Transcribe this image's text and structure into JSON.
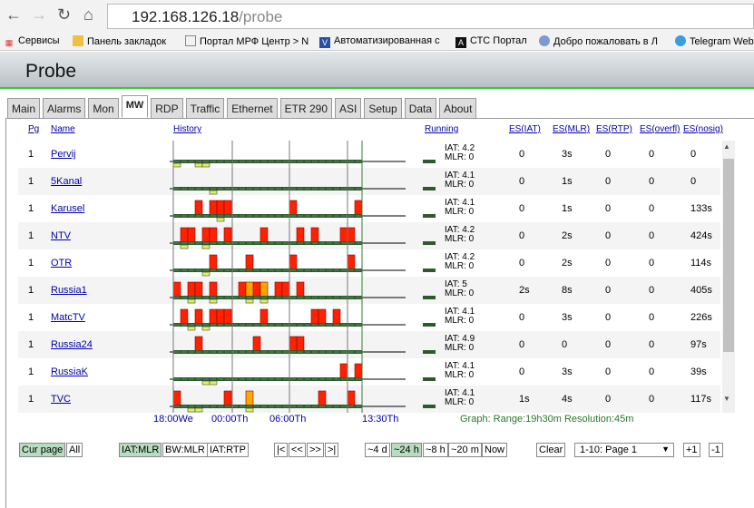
{
  "browser": {
    "url_host": "192.168.126.18",
    "url_path": "/probe",
    "bookmarks": [
      "Сервисы",
      "Панель закладок",
      "Портал МРФ Центр > N",
      "Автоматизированная с",
      "СТС Портал",
      "Добро пожаловать в Л",
      "Telegram Web"
    ]
  },
  "app": {
    "title": "Probe"
  },
  "tabs": [
    "Main",
    "Alarms",
    "Mon",
    "MW",
    "RDP",
    "Traffic",
    "Ethernet",
    "ETR 290",
    "ASI",
    "Setup",
    "Data",
    "About"
  ],
  "active_tab": "MW",
  "columns": {
    "pg": "Pg",
    "name": "Name",
    "history": "History",
    "running": "Running",
    "es_iat": "ES(IAT)",
    "es_mlr": "ES(MLR)",
    "es_rtp": "ES(RTP)",
    "es_overfl": "ES(overfl)",
    "es_nosig": "ES(nosig)"
  },
  "rows": [
    {
      "pg": "1",
      "name": "Pervij",
      "iat": "IAT: 4.2",
      "mlr": "MLR: 0",
      "es_iat": "0",
      "es_mlr": "3s",
      "es_rtp": "0",
      "es_overfl": "0",
      "es_nosig": "0",
      "red": [],
      "orange": [],
      "yellow": [
        0,
        3,
        4
      ]
    },
    {
      "pg": "1",
      "name": "5Kanal",
      "iat": "IAT: 4.1",
      "mlr": "MLR: 0",
      "es_iat": "0",
      "es_mlr": "1s",
      "es_rtp": "0",
      "es_overfl": "0",
      "es_nosig": "0",
      "red": [],
      "orange": [],
      "yellow": [
        5
      ]
    },
    {
      "pg": "1",
      "name": "Karusel",
      "iat": "IAT: 4.1",
      "mlr": "MLR: 0",
      "es_iat": "0",
      "es_mlr": "1s",
      "es_rtp": "0",
      "es_overfl": "0",
      "es_nosig": "133s",
      "red": [
        3,
        5,
        6,
        7,
        16,
        25
      ],
      "orange": [],
      "yellow": [
        6
      ]
    },
    {
      "pg": "1",
      "name": "NTV",
      "iat": "IAT: 4.2",
      "mlr": "MLR: 0",
      "es_iat": "0",
      "es_mlr": "2s",
      "es_rtp": "0",
      "es_overfl": "0",
      "es_nosig": "424s",
      "red": [
        1,
        2,
        4,
        5,
        7,
        12,
        17,
        19,
        23,
        24
      ],
      "orange": [],
      "yellow": [
        1,
        4
      ]
    },
    {
      "pg": "1",
      "name": "OTR",
      "iat": "IAT: 4.2",
      "mlr": "MLR: 0",
      "es_iat": "0",
      "es_mlr": "2s",
      "es_rtp": "0",
      "es_overfl": "0",
      "es_nosig": "114s",
      "red": [
        5,
        10,
        16,
        24
      ],
      "orange": [],
      "yellow": [
        4
      ]
    },
    {
      "pg": "1",
      "name": "Russia1",
      "iat": "IAT: 5",
      "mlr": "MLR: 0",
      "es_iat": "2s",
      "es_mlr": "8s",
      "es_rtp": "0",
      "es_overfl": "0",
      "es_nosig": "405s",
      "red": [
        0,
        2,
        3,
        5,
        9,
        11,
        14,
        15,
        17
      ],
      "orange": [
        10,
        12
      ],
      "yellow": [
        2,
        5,
        10,
        12
      ]
    },
    {
      "pg": "1",
      "name": "MatcTV",
      "iat": "IAT: 4.1",
      "mlr": "MLR: 0",
      "es_iat": "0",
      "es_mlr": "3s",
      "es_rtp": "0",
      "es_overfl": "0",
      "es_nosig": "226s",
      "red": [
        1,
        3,
        5,
        6,
        7,
        12,
        19,
        20,
        22
      ],
      "orange": [],
      "yellow": [
        2,
        4
      ]
    },
    {
      "pg": "1",
      "name": "Russia24",
      "iat": "IAT: 4.9",
      "mlr": "MLR: 0",
      "es_iat": "0",
      "es_mlr": "0",
      "es_rtp": "0",
      "es_overfl": "0",
      "es_nosig": "97s",
      "red": [
        3,
        11,
        16,
        17
      ],
      "orange": [],
      "yellow": []
    },
    {
      "pg": "1",
      "name": "RussiaK",
      "iat": "IAT: 4.1",
      "mlr": "MLR: 0",
      "es_iat": "0",
      "es_mlr": "3s",
      "es_rtp": "0",
      "es_overfl": "0",
      "es_nosig": "39s",
      "red": [
        23,
        25
      ],
      "orange": [],
      "yellow": [
        4,
        5
      ]
    },
    {
      "pg": "1",
      "name": "TVC",
      "iat": "IAT: 4.1",
      "mlr": "MLR: 0",
      "es_iat": "1s",
      "es_mlr": "4s",
      "es_rtp": "0",
      "es_overfl": "0",
      "es_nosig": "117s",
      "red": [
        0,
        7,
        20,
        24
      ],
      "orange": [
        10
      ],
      "yellow": [
        2,
        3,
        10
      ]
    }
  ],
  "time_axis": [
    "18:00We",
    "00:00Th",
    "06:00Th",
    "13:30Th"
  ],
  "graph_info": "Graph: Range:19h30m Resolution:45m",
  "controls": {
    "cur_page": "Cur page",
    "all": "All",
    "iat_mlr": "IAT:MLR",
    "bw_mlr": "BW:MLR",
    "iat_rtp": "IAT:RTP",
    "first": "|<",
    "prev": "<<",
    "next": ">>",
    "last": ">|",
    "d4": "~4 d",
    "h24": "~24 h",
    "h8": "~8 h",
    "m20": "~20 m",
    "now": "Now",
    "clear": "Clear",
    "page_select": "1-10: Page 1",
    "plus": "+1",
    "minus": "-1"
  },
  "colors": {
    "red": "#ff2200",
    "orange": "#ffa500",
    "yellow": "#e0f060",
    "green_bar": "#2d5a2d"
  }
}
